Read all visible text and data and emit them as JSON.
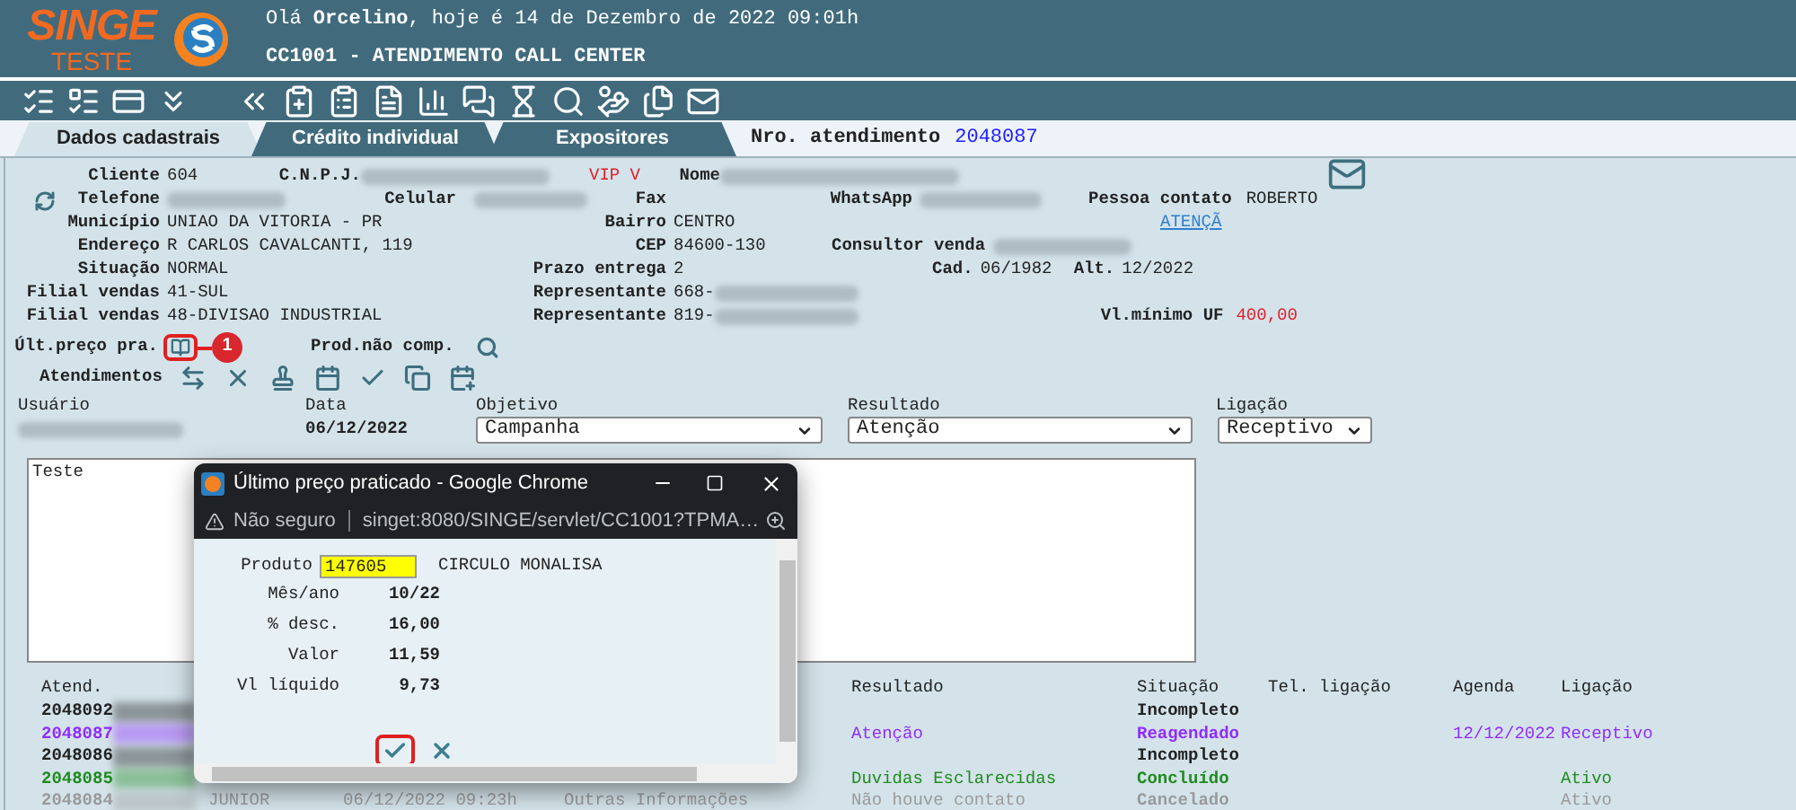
{
  "header": {
    "logo_top": "SINGE",
    "logo_bottom": "TESTE",
    "greeting": "Olá **Orcelino**, hoje é 14 de Dezembro de 2022 09:01h",
    "subtitle": "CC1001 - ATENDIMENTO CALL CENTER"
  },
  "tabs": [
    {
      "label": "Dados cadastrais",
      "selected": true
    },
    {
      "label": "Crédito individual",
      "selected": false
    },
    {
      "label": "Expositores",
      "selected": false
    }
  ],
  "atendimento": {
    "label": "Nro. atendimento",
    "value": "2048087"
  },
  "client": {
    "cliente": {
      "label": "Cliente",
      "value": "604"
    },
    "cnpj": {
      "label": "C.N.P.J."
    },
    "vip": "VIP V",
    "nome": {
      "label": "Nome"
    },
    "telefone": {
      "label": "Telefone"
    },
    "celular": {
      "label": "Celular"
    },
    "fax": {
      "label": "Fax"
    },
    "whatsapp": {
      "label": "WhatsApp"
    },
    "pessoa_contato": {
      "label": "Pessoa contato",
      "value": "ROBERTO"
    },
    "municipio": {
      "label": "Município",
      "value": "UNIAO DA VITORIA - PR"
    },
    "bairro": {
      "label": "Bairro",
      "value": "CENTRO"
    },
    "atencao_link": "ATENÇÃ",
    "endereco": {
      "label": "Endereço",
      "value": "R CARLOS CAVALCANTI, 119"
    },
    "cep": {
      "label": "CEP",
      "value": "84600-130"
    },
    "consultor": {
      "label": "Consultor venda"
    },
    "situacao": {
      "label": "Situação",
      "value": "NORMAL"
    },
    "prazo": {
      "label": "Prazo entrega",
      "value": "2"
    },
    "cad": {
      "label": "Cad.",
      "value": "06/1982"
    },
    "alt": {
      "label": "Alt.",
      "value": "12/2022"
    },
    "filiais": [
      {
        "label": "Filial vendas",
        "value": "41-SUL",
        "rep_label": "Representante",
        "rep_value": "668-"
      },
      {
        "label": "Filial vendas",
        "value": "48-DIVISAO INDUSTRIAL",
        "rep_label": "Representante",
        "rep_value": "819-"
      }
    ],
    "vl_minimo": {
      "label": "Vl.mínimo UF",
      "value": "400,00"
    }
  },
  "ult_preco": {
    "label": "Últ.preço pra.",
    "badge": "1"
  },
  "prod_nao_comp": "Prod.não comp.",
  "atendimentos_label": "Atendimentos",
  "form": {
    "usuario_label": "Usuário",
    "data_label": "Data",
    "data_value": "06/12/2022",
    "objetivo": {
      "label": "Objetivo",
      "value": "Campanha"
    },
    "resultado": {
      "label": "Resultado",
      "value": "Atenção"
    },
    "ligacao": {
      "label": "Ligação",
      "value": "Receptivo"
    },
    "notes": "Teste"
  },
  "table": {
    "columns": [
      "Atend.",
      "Resultado",
      "Situação",
      "Tel. ligação",
      "Agenda",
      "Ligação"
    ],
    "rows": [
      {
        "atend": "2048092",
        "situacao": "Incompleto",
        "color": "#222222"
      },
      {
        "atend": "2048087",
        "resultado": "Atenção",
        "situacao": "Reagendado",
        "agenda": "12/12/2022",
        "ligacao": "Receptivo",
        "color": "#8f2cff"
      },
      {
        "atend": "2048086",
        "situacao": "Incompleto",
        "color": "#222222"
      },
      {
        "atend": "2048085",
        "resultado": "Duvidas Esclarecidas",
        "situacao": "Concluído",
        "ligacao": "Ativo",
        "color": "#1f8b1f"
      },
      {
        "atend": "2048084",
        "usuario": "JUNIOR",
        "data": "06/12/2022 09:23h",
        "objetivo": "Outras Informações",
        "resultado": "Não houve contato",
        "situacao": "Cancelado",
        "ligacao": "Ativo",
        "color": "#9a9a9a"
      }
    ]
  },
  "popup": {
    "title": "Último preço praticado - Google Chrome",
    "security": "Não seguro",
    "url": "singet:8080/SINGE/servlet/CC1001?TPMA…",
    "product_label": "Produto",
    "product_code": "147605",
    "product_name": "CIRCULO MONALISA",
    "rows": [
      {
        "label": "Mês/ano",
        "value": "10/22"
      },
      {
        "label": "% desc.",
        "value": "16,00"
      },
      {
        "label": "Valor",
        "value": "11,59"
      },
      {
        "label": "Vl líquido",
        "value": "9,73"
      }
    ]
  }
}
